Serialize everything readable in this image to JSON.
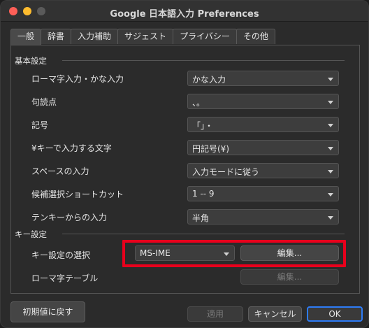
{
  "window": {
    "title": "Google 日本語入力 Preferences"
  },
  "tabs": [
    "一般",
    "辞書",
    "入力補助",
    "サジェスト",
    "プライバシー",
    "その他"
  ],
  "basic_settings": {
    "header": "基本設定",
    "rows": [
      {
        "label": "ローマ字入力・かな入力",
        "value": "かな入力"
      },
      {
        "label": "句読点",
        "value": "、。"
      },
      {
        "label": "記号",
        "value": "「」・"
      },
      {
        "label": "¥キーで入力する文字",
        "value": "円記号(¥)"
      },
      {
        "label": "スペースの入力",
        "value": "入力モードに従う"
      },
      {
        "label": "候補選択ショートカット",
        "value": "1 -- 9"
      },
      {
        "label": "テンキーからの入力",
        "value": "半角"
      }
    ]
  },
  "key_settings": {
    "header": "キー設定",
    "keymap_label": "キー設定の選択",
    "keymap_value": "MS-IME",
    "edit_button": "編集...",
    "romaji_label": "ローマ字テーブル",
    "romaji_edit_button": "編集..."
  },
  "footer": {
    "reset_button": "初期値に戻す",
    "apply_button": "適用",
    "cancel_button": "キャンセル",
    "ok_button": "OK"
  },
  "colors": {
    "highlight": "#e8001c",
    "focus": "#2e7cf6"
  }
}
